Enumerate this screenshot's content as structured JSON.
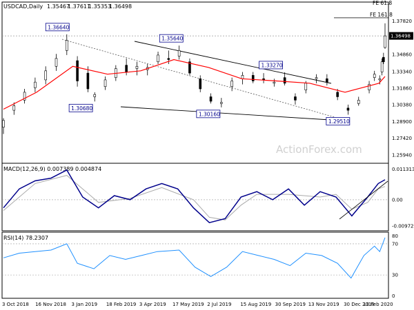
{
  "chart_data": [
    {
      "type": "candlestick",
      "title": "USDCAD,Daily",
      "ohlc": [
        "1.35467",
        "1.37611",
        "1.35353",
        "1.36498"
      ],
      "last_price_label": "1.36498",
      "y_ticks": [
        "1.37820",
        "1.34860",
        "1.33340",
        "1.31860",
        "1.30380",
        "1.28900",
        "1.27420",
        "1.25940"
      ],
      "x_ticks": [
        "3 Oct 2018",
        "16 Nov 2018",
        "3 Jan 2019",
        "18 Feb 2019",
        "3 Apr 2019",
        "17 May 2019",
        "2 Jul 2019",
        "15 Aug 2019",
        "30 Sep 2019",
        "13 Nov 2019",
        "30 Dec 2019",
        "13 Feb 2020"
      ],
      "ylim": [
        1.252,
        1.395
      ],
      "watermark": "ActionForex.com",
      "price_labels": [
        {
          "text": "1.36640",
          "date": "2018-12-31",
          "price": 1.3664
        },
        {
          "text": "1.30680",
          "date": "2019-01-31",
          "price": 1.3068
        },
        {
          "text": "1.35640",
          "date": "2019-05-31",
          "price": 1.3564
        },
        {
          "text": "1.30160",
          "date": "2019-07-19",
          "price": 1.3016
        },
        {
          "text": "1.33270",
          "date": "2019-10-10",
          "price": 1.3327
        },
        {
          "text": "1.29510",
          "date": "2020-01-07",
          "price": 1.2951
        }
      ],
      "fib_labels": [
        {
          "text": "FE 61.8",
          "price": 1.3945
        },
        {
          "text": "FE 161.8",
          "price": 1.381
        }
      ],
      "moving_average": [
        {
          "date": "2018-10-03",
          "price": 1.3
        },
        {
          "date": "2018-11-16",
          "price": 1.315
        },
        {
          "date": "2019-01-03",
          "price": 1.338
        },
        {
          "date": "2019-02-18",
          "price": 1.331
        },
        {
          "date": "2019-04-03",
          "price": 1.334
        },
        {
          "date": "2019-05-17",
          "price": 1.344
        },
        {
          "date": "2019-07-02",
          "price": 1.337
        },
        {
          "date": "2019-08-15",
          "price": 1.327
        },
        {
          "date": "2019-09-30",
          "price": 1.325
        },
        {
          "date": "2019-11-13",
          "price": 1.323
        },
        {
          "date": "2019-12-30",
          "price": 1.315
        },
        {
          "date": "2020-02-13",
          "price": 1.323
        },
        {
          "date": "2020-02-21",
          "price": 1.329
        }
      ],
      "candles": [
        {
          "date": "2018-10-03",
          "open": 1.284,
          "high": 1.292,
          "low": 1.278,
          "close": 1.29
        },
        {
          "date": "2018-10-17",
          "open": 1.299,
          "high": 1.306,
          "low": 1.295,
          "close": 1.303
        },
        {
          "date": "2018-10-31",
          "open": 1.308,
          "high": 1.318,
          "low": 1.305,
          "close": 1.315
        },
        {
          "date": "2018-11-14",
          "open": 1.319,
          "high": 1.328,
          "low": 1.315,
          "close": 1.324
        },
        {
          "date": "2018-11-28",
          "open": 1.326,
          "high": 1.338,
          "low": 1.322,
          "close": 1.334
        },
        {
          "date": "2018-12-12",
          "open": 1.338,
          "high": 1.349,
          "low": 1.334,
          "close": 1.345
        },
        {
          "date": "2018-12-26",
          "open": 1.352,
          "high": 1.3664,
          "low": 1.348,
          "close": 1.361
        },
        {
          "date": "2019-01-09",
          "open": 1.343,
          "high": 1.347,
          "low": 1.32,
          "close": 1.325
        },
        {
          "date": "2019-01-23",
          "open": 1.332,
          "high": 1.338,
          "low": 1.315,
          "close": 1.318
        },
        {
          "date": "2019-02-01",
          "open": 1.311,
          "high": 1.315,
          "low": 1.3068,
          "close": 1.313
        },
        {
          "date": "2019-02-15",
          "open": 1.32,
          "high": 1.329,
          "low": 1.317,
          "close": 1.326
        },
        {
          "date": "2019-03-01",
          "open": 1.328,
          "high": 1.339,
          "low": 1.325,
          "close": 1.336
        },
        {
          "date": "2019-03-15",
          "open": 1.339,
          "high": 1.345,
          "low": 1.33,
          "close": 1.333
        },
        {
          "date": "2019-03-29",
          "open": 1.336,
          "high": 1.342,
          "low": 1.33,
          "close": 1.338
        },
        {
          "date": "2019-04-12",
          "open": 1.335,
          "high": 1.34,
          "low": 1.33,
          "close": 1.337
        },
        {
          "date": "2019-04-26",
          "open": 1.342,
          "high": 1.351,
          "low": 1.34,
          "close": 1.348
        },
        {
          "date": "2019-05-10",
          "open": 1.345,
          "high": 1.352,
          "low": 1.34,
          "close": 1.344
        },
        {
          "date": "2019-05-24",
          "open": 1.347,
          "high": 1.3564,
          "low": 1.344,
          "close": 1.352
        },
        {
          "date": "2019-06-07",
          "open": 1.342,
          "high": 1.345,
          "low": 1.33,
          "close": 1.332
        },
        {
          "date": "2019-06-21",
          "open": 1.327,
          "high": 1.33,
          "low": 1.315,
          "close": 1.318
        },
        {
          "date": "2019-07-05",
          "open": 1.311,
          "high": 1.314,
          "low": 1.305,
          "close": 1.307
        },
        {
          "date": "2019-07-19",
          "open": 1.305,
          "high": 1.31,
          "low": 1.3016,
          "close": 1.306
        },
        {
          "date": "2019-08-02",
          "open": 1.32,
          "high": 1.328,
          "low": 1.316,
          "close": 1.325
        },
        {
          "date": "2019-08-16",
          "open": 1.327,
          "high": 1.333,
          "low": 1.322,
          "close": 1.33
        },
        {
          "date": "2019-08-30",
          "open": 1.33,
          "high": 1.333,
          "low": 1.323,
          "close": 1.325
        },
        {
          "date": "2019-09-13",
          "open": 1.327,
          "high": 1.332,
          "low": 1.323,
          "close": 1.326
        },
        {
          "date": "2019-09-27",
          "open": 1.323,
          "high": 1.327,
          "low": 1.32,
          "close": 1.324
        },
        {
          "date": "2019-10-11",
          "open": 1.328,
          "high": 1.3327,
          "low": 1.321,
          "close": 1.323
        },
        {
          "date": "2019-10-25",
          "open": 1.311,
          "high": 1.314,
          "low": 1.304,
          "close": 1.308
        },
        {
          "date": "2019-11-08",
          "open": 1.317,
          "high": 1.325,
          "low": 1.314,
          "close": 1.323
        },
        {
          "date": "2019-11-22",
          "open": 1.327,
          "high": 1.331,
          "low": 1.323,
          "close": 1.328
        },
        {
          "date": "2019-12-06",
          "open": 1.327,
          "high": 1.331,
          "low": 1.321,
          "close": 1.324
        },
        {
          "date": "2019-12-20",
          "open": 1.315,
          "high": 1.318,
          "low": 1.308,
          "close": 1.311
        },
        {
          "date": "2020-01-03",
          "open": 1.301,
          "high": 1.304,
          "low": 1.2951,
          "close": 1.299
        },
        {
          "date": "2020-01-17",
          "open": 1.305,
          "high": 1.311,
          "low": 1.303,
          "close": 1.308
        },
        {
          "date": "2020-01-31",
          "open": 1.317,
          "high": 1.325,
          "low": 1.314,
          "close": 1.322
        },
        {
          "date": "2020-02-07",
          "open": 1.328,
          "high": 1.334,
          "low": 1.325,
          "close": 1.331
        },
        {
          "date": "2020-02-14",
          "open": 1.326,
          "high": 1.33,
          "low": 1.322,
          "close": 1.327
        },
        {
          "date": "2020-02-17",
          "open": 1.333,
          "high": 1.345,
          "low": 1.33,
          "close": 1.342
        },
        {
          "date": "2020-02-19",
          "open": 1.346,
          "high": 1.35,
          "low": 1.34,
          "close": 1.342
        },
        {
          "date": "2020-02-21",
          "open": 1.3547,
          "high": 1.3761,
          "low": 1.3535,
          "close": 1.365
        }
      ]
    },
    {
      "type": "line",
      "title": "MACD(12,26,9) 0.007389 0.004874",
      "y_ticks": [
        "0.011313",
        "0.00",
        "-0.009729"
      ],
      "ylim": [
        -0.0115,
        0.0135
      ],
      "series": [
        {
          "points": [
            {
              "date": "2018-10-03",
              "value": -0.003
            },
            {
              "date": "2018-10-24",
              "value": 0.004
            },
            {
              "date": "2018-11-14",
              "value": 0.007
            },
            {
              "date": "2018-12-05",
              "value": 0.008
            },
            {
              "date": "2018-12-26",
              "value": 0.011
            },
            {
              "date": "2019-01-16",
              "value": 0.001
            },
            {
              "date": "2019-02-06",
              "value": -0.003
            },
            {
              "date": "2019-02-27",
              "value": 0.0015
            },
            {
              "date": "2019-03-20",
              "value": 0.0
            },
            {
              "date": "2019-04-10",
              "value": 0.004
            },
            {
              "date": "2019-05-01",
              "value": 0.006
            },
            {
              "date": "2019-05-22",
              "value": 0.004
            },
            {
              "date": "2019-06-12",
              "value": -0.003
            },
            {
              "date": "2019-07-03",
              "value": -0.0085
            },
            {
              "date": "2019-07-24",
              "value": -0.007
            },
            {
              "date": "2019-08-14",
              "value": 0.001
            },
            {
              "date": "2019-09-04",
              "value": 0.003
            },
            {
              "date": "2019-09-25",
              "value": 0.0
            },
            {
              "date": "2019-10-16",
              "value": 0.004
            },
            {
              "date": "2019-11-06",
              "value": -0.002
            },
            {
              "date": "2019-11-27",
              "value": 0.003
            },
            {
              "date": "2019-12-18",
              "value": 0.001
            },
            {
              "date": "2020-01-08",
              "value": -0.006
            },
            {
              "date": "2020-01-29",
              "value": 0.001
            },
            {
              "date": "2020-02-12",
              "value": 0.006
            },
            {
              "date": "2020-02-21",
              "value": 0.0074
            }
          ]
        },
        {
          "points": [
            {
              "date": "2018-10-03",
              "value": -0.004
            },
            {
              "date": "2018-11-14",
              "value": 0.006
            },
            {
              "date": "2018-12-26",
              "value": 0.009
            },
            {
              "date": "2019-01-16",
              "value": 0.004
            },
            {
              "date": "2019-02-06",
              "value": -0.001
            },
            {
              "date": "2019-03-20",
              "value": 0.0005
            },
            {
              "date": "2019-05-01",
              "value": 0.0045
            },
            {
              "date": "2019-06-12",
              "value": 0.0
            },
            {
              "date": "2019-07-03",
              "value": -0.0065
            },
            {
              "date": "2019-07-24",
              "value": -0.0075
            },
            {
              "date": "2019-08-14",
              "value": -0.002
            },
            {
              "date": "2019-09-04",
              "value": 0.002
            },
            {
              "date": "2019-10-16",
              "value": 0.002
            },
            {
              "date": "2019-11-27",
              "value": 0.001
            },
            {
              "date": "2019-12-18",
              "value": 0.002
            },
            {
              "date": "2020-01-08",
              "value": -0.0035
            },
            {
              "date": "2020-01-29",
              "value": -0.001
            },
            {
              "date": "2020-02-12",
              "value": 0.004
            },
            {
              "date": "2020-02-21",
              "value": 0.0049
            }
          ]
        }
      ]
    },
    {
      "type": "line",
      "title": "RSI(14) 78.2307",
      "y_ticks": [
        "80",
        "70",
        "30",
        "0"
      ],
      "ylim": [
        0,
        85
      ],
      "series": [
        {
          "points": [
            {
              "date": "2018-10-03",
              "value": 52
            },
            {
              "date": "2018-10-24",
              "value": 58
            },
            {
              "date": "2018-11-14",
              "value": 60
            },
            {
              "date": "2018-12-05",
              "value": 62
            },
            {
              "date": "2018-12-26",
              "value": 70
            },
            {
              "date": "2019-01-09",
              "value": 45
            },
            {
              "date": "2019-01-31",
              "value": 38
            },
            {
              "date": "2019-02-21",
              "value": 55
            },
            {
              "date": "2019-03-14",
              "value": 50
            },
            {
              "date": "2019-04-04",
              "value": 55
            },
            {
              "date": "2019-04-25",
              "value": 60
            },
            {
              "date": "2019-05-24",
              "value": 62
            },
            {
              "date": "2019-06-14",
              "value": 40
            },
            {
              "date": "2019-07-05",
              "value": 28
            },
            {
              "date": "2019-07-26",
              "value": 40
            },
            {
              "date": "2019-08-16",
              "value": 60
            },
            {
              "date": "2019-09-06",
              "value": 55
            },
            {
              "date": "2019-09-27",
              "value": 50
            },
            {
              "date": "2019-10-18",
              "value": 42
            },
            {
              "date": "2019-11-08",
              "value": 58
            },
            {
              "date": "2019-11-29",
              "value": 55
            },
            {
              "date": "2019-12-20",
              "value": 45
            },
            {
              "date": "2020-01-07",
              "value": 26
            },
            {
              "date": "2020-01-24",
              "value": 55
            },
            {
              "date": "2020-02-07",
              "value": 67
            },
            {
              "date": "2020-02-14",
              "value": 60
            },
            {
              "date": "2020-02-21",
              "value": 78
            }
          ]
        }
      ]
    }
  ]
}
